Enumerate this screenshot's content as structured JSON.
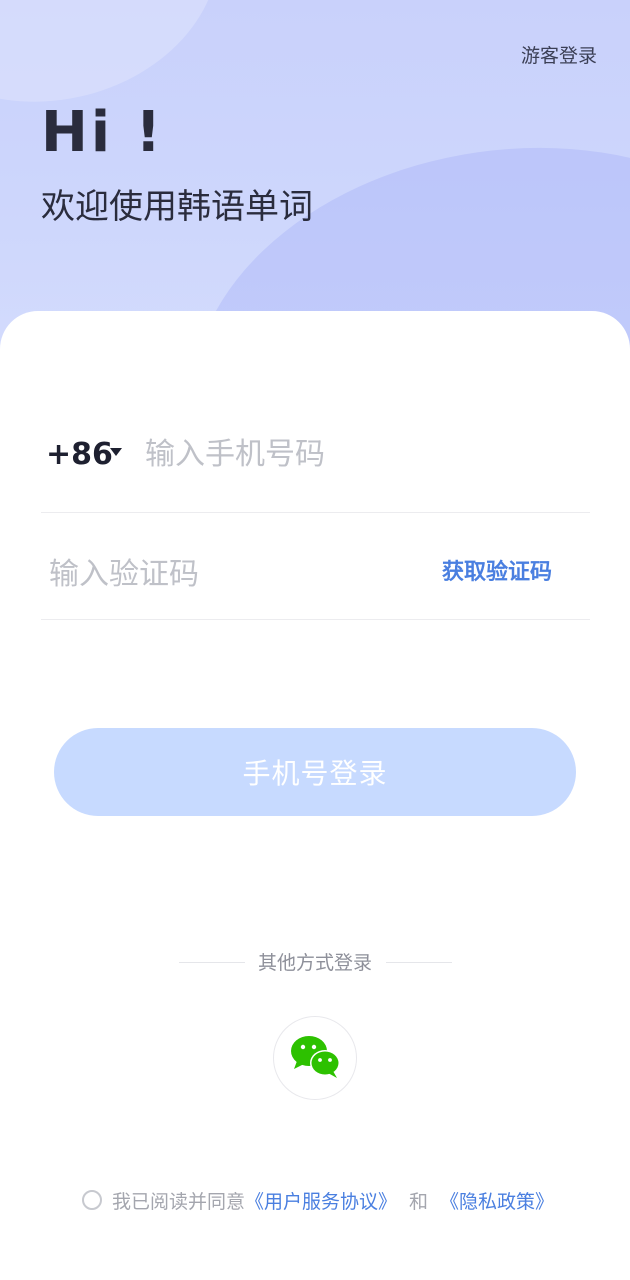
{
  "header": {
    "guest_login": "游客登录",
    "greeting": "Hi !",
    "welcome": "欢迎使用韩语单词"
  },
  "form": {
    "country_code": "+86",
    "phone_placeholder": "输入手机号码",
    "phone_value": "",
    "code_placeholder": "输入验证码",
    "code_value": "",
    "get_code": "获取验证码",
    "submit": "手机号登录"
  },
  "other_login": {
    "title": "其他方式登录",
    "wechat_icon": "wechat-icon"
  },
  "agreement": {
    "checked": false,
    "prefix": "我已阅读并同意",
    "user_agreement": "《用户服务协议》",
    "and": "和",
    "privacy_policy": "《隐私政策》"
  },
  "colors": {
    "accent": "#4a7fe0",
    "button_disabled": "#c7daff",
    "wechat_green": "#2dc100",
    "header_bg": "#c9d1fb"
  }
}
